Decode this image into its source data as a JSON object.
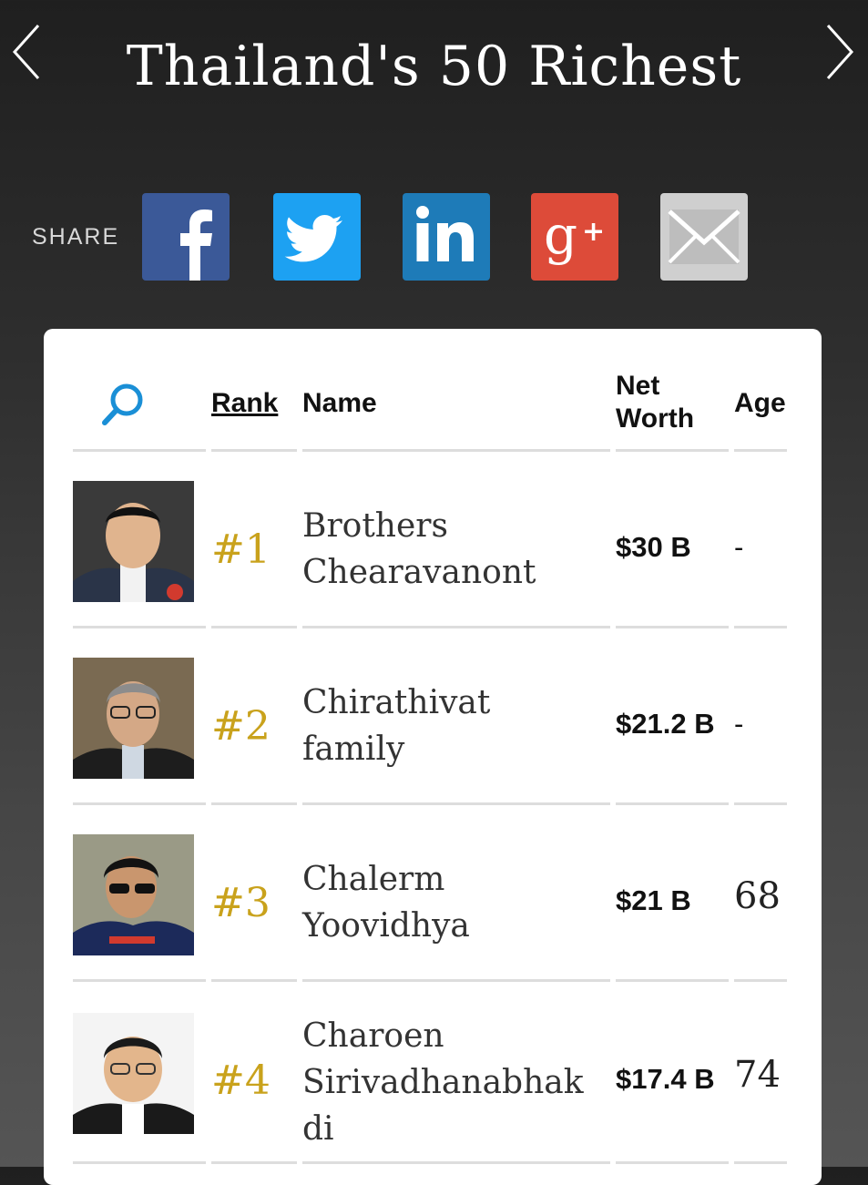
{
  "header": {
    "title": "Thailand's 50 Richest",
    "prev_icon": "chevron-left-icon",
    "next_icon": "chevron-right-icon"
  },
  "share": {
    "label": "SHARE",
    "buttons": [
      {
        "name": "facebook",
        "icon": "facebook-icon",
        "color": "#3b5998"
      },
      {
        "name": "twitter",
        "icon": "twitter-icon",
        "color": "#1da1f2"
      },
      {
        "name": "linkedin",
        "icon": "linkedin-icon",
        "color": "#1e7bb8"
      },
      {
        "name": "google-plus",
        "icon": "google-plus-icon",
        "color": "#dd4b39"
      },
      {
        "name": "email",
        "icon": "mail-icon",
        "color": "#cfcfcf"
      }
    ]
  },
  "table": {
    "search_icon": "search-icon",
    "headers": {
      "rank": "Rank",
      "name": "Name",
      "net_worth_line1": "Net",
      "net_worth_line2": "Worth",
      "age": "Age"
    },
    "rows": [
      {
        "rank": "#1",
        "name_line1": "Brothers",
        "name_line2": "Chearavanont",
        "name_line3": "",
        "net_worth": "$30 B",
        "age": "-"
      },
      {
        "rank": "#2",
        "name_line1": "Chirathivat",
        "name_line2": "family",
        "name_line3": "",
        "net_worth": "$21.2 B",
        "age": "-"
      },
      {
        "rank": "#3",
        "name_line1": "Chalerm",
        "name_line2": "Yoovidhya",
        "name_line3": "",
        "net_worth": "$21 B",
        "age": "68"
      },
      {
        "rank": "#4",
        "name_line1": "Charoen",
        "name_line2": "Sirivadhanabhak",
        "name_line3": "di",
        "net_worth": "$17.4 B",
        "age": "74"
      }
    ]
  },
  "colors": {
    "accent_rank": "#c9a21c",
    "card_bg": "#ffffff"
  }
}
